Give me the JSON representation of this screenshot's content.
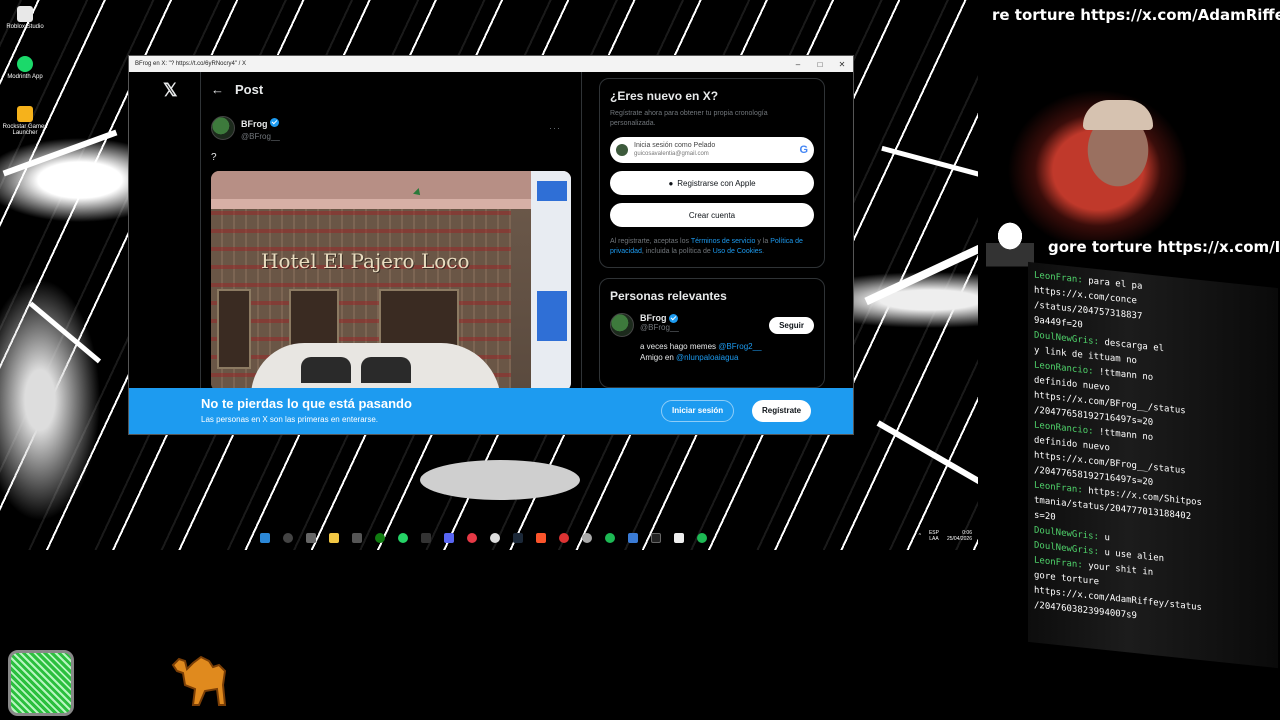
{
  "desktop": {
    "icons": [
      {
        "label": "Roblox Studio",
        "color": "#e8e8e8"
      },
      {
        "label": "Modrinth App",
        "color": "#1bd96a"
      },
      {
        "label": "Rockstar Games Launcher",
        "color": "#f6b21b"
      }
    ]
  },
  "window": {
    "title": "BFrog en X: \"? https://t.co/6yRNocry4\" / X",
    "controls": [
      "–",
      "□",
      "✕"
    ]
  },
  "x": {
    "header_title": "Post",
    "post": {
      "author_name": "BFrog",
      "author_handle": "@BFrog__",
      "more": "···",
      "text": "?",
      "image_sign": "Hotel El Pajero Loco"
    },
    "signup_card": {
      "title": "¿Eres nuevo en X?",
      "desc": "Regístrate ahora para obtener tu propia cronología personalizada.",
      "google_line1": "Inicia sesión como Pelado",
      "google_line2": "guicosavalentia@gmail.com",
      "apple_label": "Registrarse con Apple",
      "create_label": "Crear cuenta",
      "legal_1": "Al registrarte, aceptas los ",
      "legal_link1": "Términos de servicio",
      "legal_2": " y la ",
      "legal_link2": "Política de privacidad",
      "legal_3": ", incluida la política de ",
      "legal_link3": "Uso de Cookies",
      "legal_4": "."
    },
    "relevant": {
      "title": "Personas relevantes",
      "name": "BFrog",
      "handle": "@BFrog__",
      "follow_label": "Seguir",
      "bio_1": "a veces hago memes ",
      "bio_link1": "@BFrog2__",
      "bio_2": "Amigo en ",
      "bio_link2": "@nlunpaloaiagua"
    },
    "banner": {
      "title": "No te pierdas lo que está pasando",
      "subtitle": "Las personas en X son las primeras en enterarse.",
      "login_label": "Iniciar sesión",
      "signup_label": "Regístrate"
    }
  },
  "taskbar": {
    "lang_top": "ESP",
    "lang_bottom": "LAA",
    "time": "0:06",
    "date": "25/04/2026"
  },
  "stream": {
    "marquee_top": "re torture https://x.com/AdamRiffey",
    "marquee_mid": "gore torture https://x.com/I",
    "chat_lines": [
      {
        "user": "LeonFran",
        "text": "para el pa"
      },
      {
        "user": "",
        "text": "https://x.com/conce"
      },
      {
        "user": "",
        "text": "/status/204757318837"
      },
      {
        "user": "",
        "text": "9a449f=20"
      },
      {
        "user": "DoulNewGris",
        "text": "descarga el"
      },
      {
        "user": "",
        "text": "y link de ittuam no"
      },
      {
        "user": "LeonRancio",
        "text": "!ttmann no"
      },
      {
        "user": "",
        "text": "definido nuevo"
      },
      {
        "user": "",
        "text": "https://x.com/BFrog__/status"
      },
      {
        "user": "",
        "text": "/20477658192716497s=20"
      },
      {
        "user": "LeonRancio",
        "text": "!ttmann no"
      },
      {
        "user": "",
        "text": "definido nuevo"
      },
      {
        "user": "",
        "text": "https://x.com/BFrog__/status"
      },
      {
        "user": "",
        "text": "/20477658192716497s=20"
      },
      {
        "user": "LeonFran",
        "text": "https://x.com/Shitpos"
      },
      {
        "user": "",
        "text": "tmania/status/204777013188402"
      },
      {
        "user": "",
        "text": "s=20"
      },
      {
        "user": "DoulNewGris",
        "text": "u"
      },
      {
        "user": "DoulNewGris",
        "text": "u use alien"
      },
      {
        "user": "LeonFran",
        "text": "your shit in"
      },
      {
        "user": "",
        "text": "gore torture"
      },
      {
        "user": "",
        "text": "https://x.com/AdamRiffey/status"
      },
      {
        "user": "",
        "text": "/2047603823994007s9"
      }
    ]
  }
}
